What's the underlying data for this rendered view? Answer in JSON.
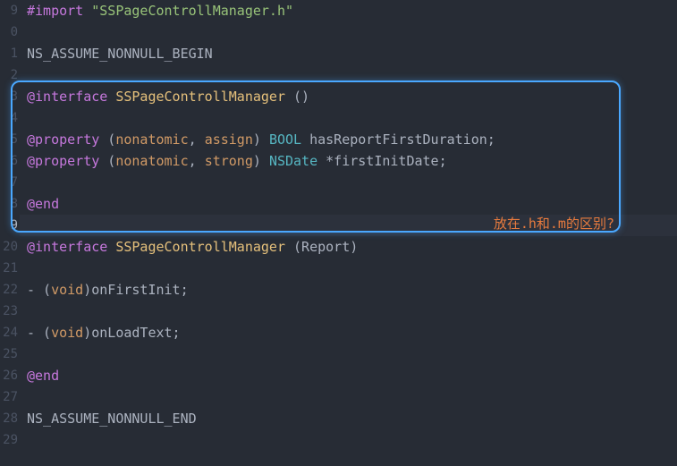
{
  "lineNumbers": [
    "9",
    "0",
    "1",
    "2",
    "3",
    "4",
    "5",
    "6",
    "7",
    "8",
    "9",
    "20",
    "21",
    "22",
    "23",
    "24",
    "25",
    "26",
    "27",
    "28",
    "29"
  ],
  "highlightedLineIndex": 10,
  "annotation": "放在.h和.m的区别?",
  "code": {
    "l0": {
      "directive": "#import",
      "string": "\"SSPageControllManager.h\""
    },
    "l2": {
      "text": "NS_ASSUME_NONNULL_BEGIN"
    },
    "l4": {
      "kw": "@interface",
      "cls": "SSPageControllManager",
      "rest": " ()"
    },
    "l6": {
      "kw": "@property",
      "p1": " (",
      "a1": "nonatomic",
      "c": ", ",
      "a2": "assign",
      "p2": ") ",
      "type": "BOOL",
      "name": " hasReportFirstDuration;"
    },
    "l7": {
      "kw": "@property",
      "p1": " (",
      "a1": "nonatomic",
      "c": ", ",
      "a2": "strong",
      "p2": ") ",
      "type": "NSDate",
      "name": " *firstInitDate;"
    },
    "l9": {
      "kw": "@end"
    },
    "l11": {
      "kw": "@interface",
      "cls": "SSPageControllManager",
      "rest": " (Report)"
    },
    "l13": {
      "pre": "- (",
      "void": "void",
      "rest": ")onFirstInit;"
    },
    "l15": {
      "pre": "- (",
      "void": "void",
      "rest": ")onLoadText;"
    },
    "l17": {
      "kw": "@end"
    },
    "l19": {
      "text": "NS_ASSUME_NONNULL_END"
    }
  }
}
